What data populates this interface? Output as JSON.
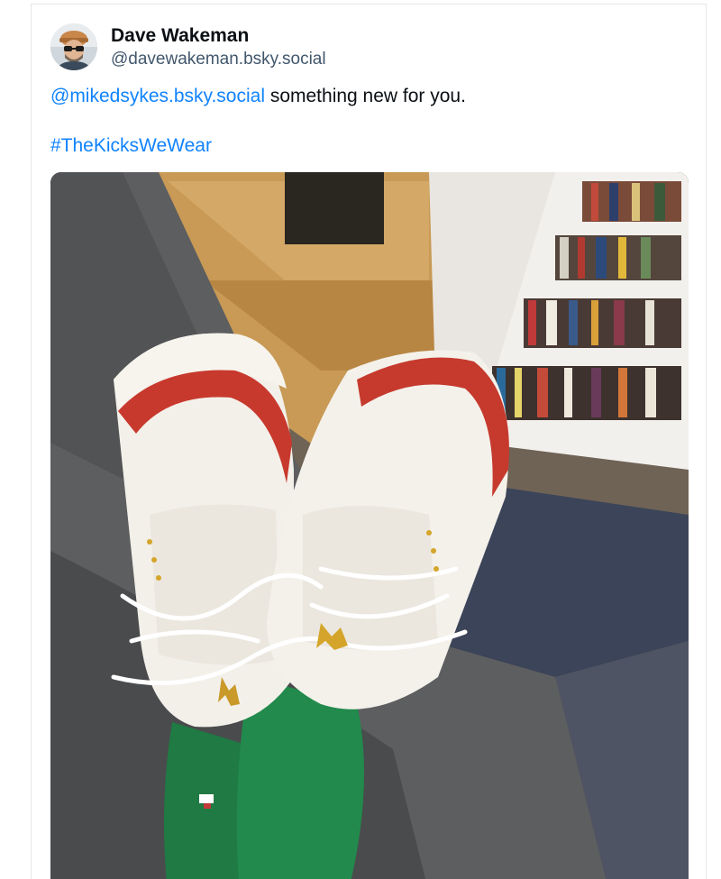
{
  "post": {
    "author": {
      "display_name": "Dave Wakeman",
      "handle": "@davewakeman.bsky.social"
    },
    "text": {
      "mention": "@mikedsykes.bsky.social",
      "body": " something new for you.",
      "hashtag": "#TheKicksWeWear"
    },
    "colors": {
      "link": "#1083fe",
      "name": "#0b0f14",
      "handle": "#42576c",
      "border": "#e4e7eb"
    }
  }
}
